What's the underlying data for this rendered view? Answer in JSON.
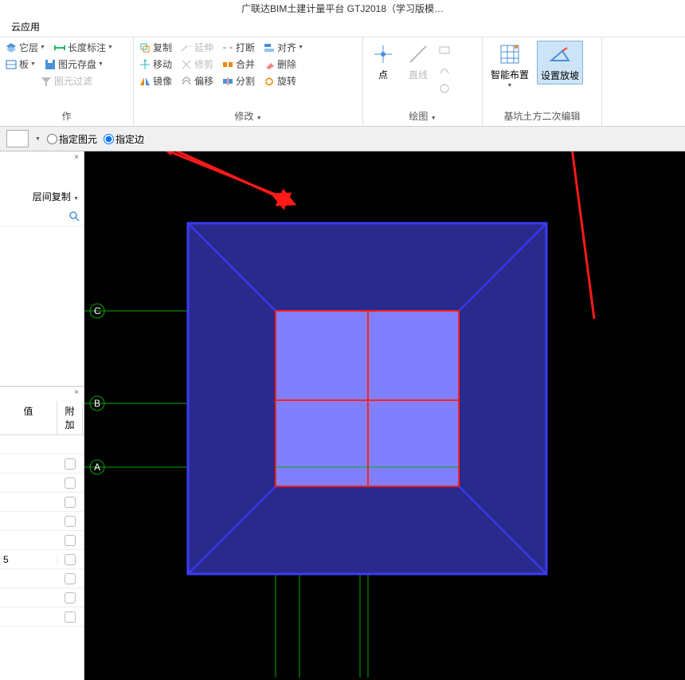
{
  "title": "广联达BIM土建计量平台 GTJ2018（学习版模…",
  "menubar": {
    "item1": "云应用"
  },
  "toolbar": {
    "group1": {
      "item1": "它层",
      "item2": "长度标注",
      "item3": "板",
      "item4": "图元存盘",
      "item5": "图元过滤",
      "label": "作"
    },
    "group2": {
      "copy": "复制",
      "extend": "延伸",
      "break": "打断",
      "align": "对齐",
      "move": "移动",
      "trim": "修剪",
      "merge": "合并",
      "delete": "删除",
      "mirror": "镜像",
      "offset": "偏移",
      "split": "分割",
      "rotate": "旋转",
      "label": "修改"
    },
    "group3": {
      "point": "点",
      "line": "直线",
      "label": "绘图"
    },
    "group4": {
      "smart": "智能布置",
      "slope": "设置放坡",
      "label": "基坑土方二次编辑"
    }
  },
  "subbar": {
    "radio1": "指定图元",
    "radio2": "指定边"
  },
  "panel": {
    "between": "层间复制",
    "col1": "值",
    "col2": "附加",
    "row6": "5"
  },
  "axis": {
    "a": "A",
    "b": "B",
    "c": "C"
  }
}
